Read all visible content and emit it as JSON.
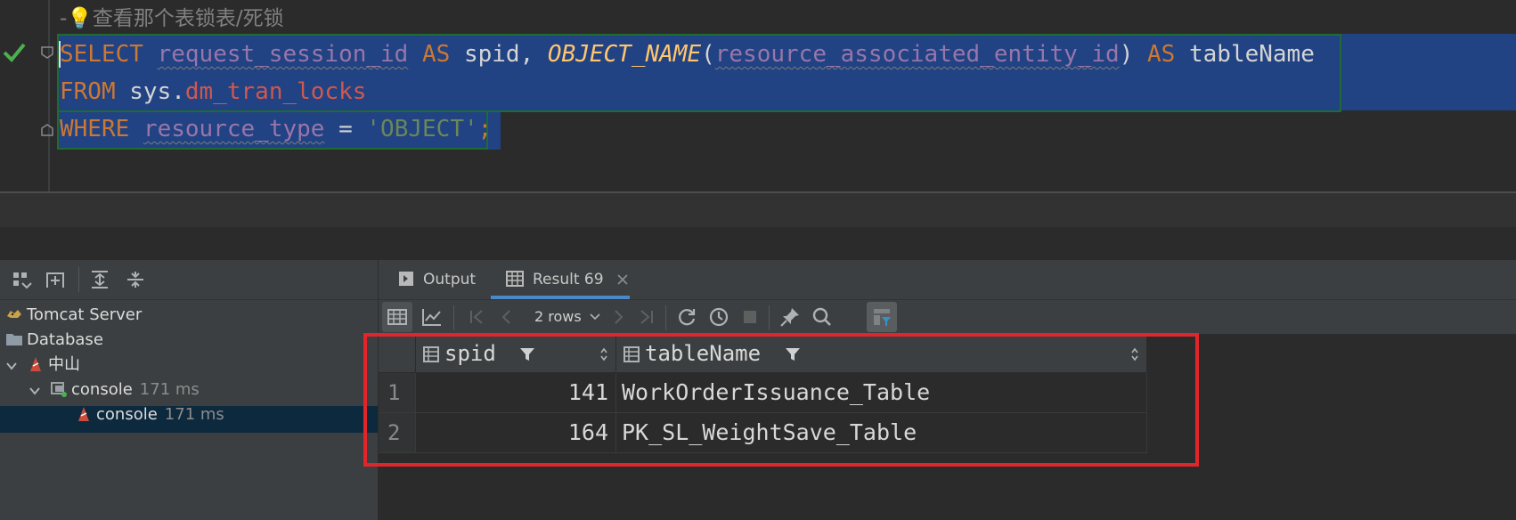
{
  "editor": {
    "comment": "-💡查看那个表锁表/死锁",
    "line1": {
      "select": "SELECT",
      "col1": "request_session_id",
      "as1": "AS",
      "alias1": "spid,",
      "func": "OBJECT_NAME",
      "lparen": "(",
      "col2": "resource_associated_entity_id",
      "rparen": ")",
      "as2": "AS",
      "alias2": "tableName"
    },
    "line2": {
      "from": "FROM",
      "schema": "sys.",
      "table": "dm_tran_locks"
    },
    "line3": {
      "where": "WHERE",
      "col": "resource_type",
      "eq": "=",
      "str": "'OBJECT'",
      "semi": ";"
    }
  },
  "left_panel": {
    "tree": [
      {
        "label": "Tomcat Server",
        "icon": "tomcat-icon"
      },
      {
        "label": "Database",
        "icon": "folder-icon"
      },
      {
        "label": "中山",
        "icon": "sqlserver-icon"
      },
      {
        "label": "console",
        "time": "171 ms",
        "icon": "console-icon"
      },
      {
        "label": "console",
        "time": "171 ms",
        "icon": "sqlserver-icon"
      }
    ]
  },
  "results": {
    "tabs": [
      {
        "label": "Output",
        "icon": "output-icon"
      },
      {
        "label": "Result 69",
        "icon": "table-icon"
      }
    ],
    "rows_label": "2 rows",
    "columns": [
      "spid",
      "tableName"
    ],
    "rows": [
      {
        "num": "1",
        "spid": "141",
        "tableName": "WorkOrderIssuance_Table"
      },
      {
        "num": "2",
        "spid": "164",
        "tableName": "PK_SL_WeightSave_Table"
      }
    ],
    "highlight_color": "#e0262a"
  }
}
